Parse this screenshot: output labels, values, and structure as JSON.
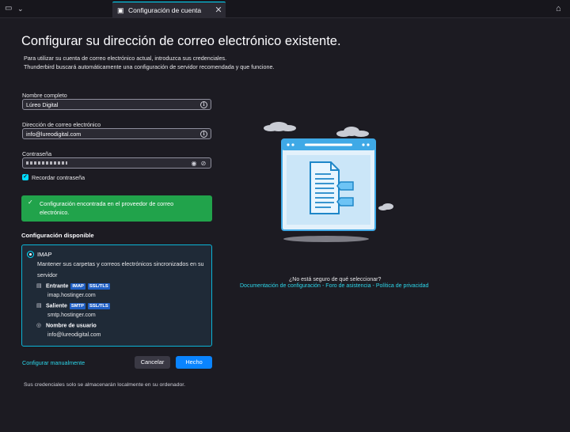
{
  "tab": {
    "title": "Configuración de cuenta",
    "close": "✕"
  },
  "header": {
    "title": "Configurar su dirección de correo electrónico existente.",
    "subtitle_line1": "Para utilizar su cuenta de correo electrónico actual, introduzca sus credenciales.",
    "subtitle_line2": "Thunderbird buscará automáticamente una configuración de servidor recomendada y que funcione."
  },
  "form": {
    "name_label": "Nombre completo",
    "name_value": "Lúreo Digital",
    "email_label": "Dirección de correo electrónico",
    "email_value": "info@lureodigital.com",
    "password_label": "Contraseña",
    "remember_label": "Recordar contraseña",
    "remember_checked": true
  },
  "notice": {
    "text": "Configuración encontrada en el proveedor de correo electrónico."
  },
  "config": {
    "section_title": "Configuración disponible",
    "protocol": "IMAP",
    "description": "Mantener sus carpetas y correos electrónicos sincronizados en su servidor",
    "incoming_label": "Entrante",
    "incoming_badges": [
      "IMAP",
      "SSL/TLS"
    ],
    "incoming_host": "imap.hostinger.com",
    "outgoing_label": "Saliente",
    "outgoing_badges": [
      "SMTP",
      "SSL/TLS"
    ],
    "outgoing_host": "smtp.hostinger.com",
    "username_label": "Nombre de usuario",
    "username_value": "info@lureodigital.com"
  },
  "actions": {
    "manual": "Configurar manualmente",
    "cancel": "Cancelar",
    "done": "Hecho"
  },
  "footer": "Sus credenciales solo se almacenarán localmente en su ordenador.",
  "help": {
    "question": "¿No está seguro de qué seleccionar?",
    "link_docs": "Documentación de configuración",
    "link_support": "Foro de asistencia",
    "link_privacy": "Política de privacidad",
    "separator": "-"
  },
  "colors": {
    "accent": "#0df",
    "success": "#21a34b",
    "primary_button": "#0a84ff",
    "badge": "#2160c4",
    "background": "#1c1b22"
  },
  "icons": [
    "folder-icon",
    "chevron-down-icon",
    "settings-tab-icon",
    "close-icon",
    "app-icon",
    "info-icon",
    "eye-icon",
    "eye-off-icon",
    "check-icon",
    "incoming-server-icon",
    "outgoing-server-icon",
    "user-icon"
  ]
}
